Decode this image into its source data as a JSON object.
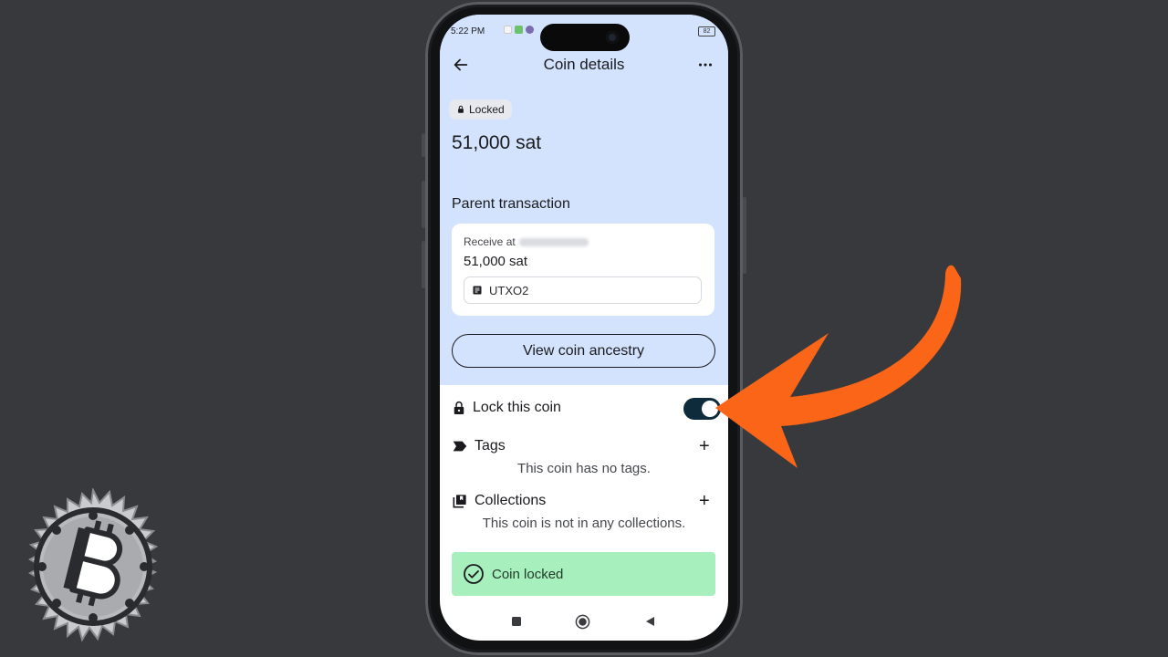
{
  "status_bar": {
    "time": "5:22 PM",
    "battery": "82"
  },
  "app_bar": {
    "title": "Coin details"
  },
  "coin": {
    "locked_chip": "Locked",
    "amount": "51,000 sat"
  },
  "parent_transaction": {
    "heading": "Parent transaction",
    "receive_prefix": "Receive at",
    "amount": "51,000 sat",
    "utxo_label": "UTXO2"
  },
  "ancestry_button": "View coin ancestry",
  "lock_row": {
    "label": "Lock this coin",
    "enabled": true
  },
  "tags": {
    "label": "Tags",
    "empty_text": "This coin has no tags."
  },
  "collections": {
    "label": "Collections",
    "empty_text": "This coin is not in any collections."
  },
  "toast": {
    "text": "Coin locked"
  },
  "colors": {
    "top_area_bg": "#d3e3fd",
    "toggle_on": "#0d2b3a",
    "toast_bg": "#a8efbe",
    "annotation_arrow": "#fa6517",
    "page_bg": "#38393d"
  },
  "icons": {
    "back": "arrow-left-icon",
    "more": "more-horizontal-icon",
    "lock": "lock-icon",
    "tag": "tag-icon",
    "collections": "collections-icon",
    "check": "check-circle-icon",
    "utxo": "document-icon",
    "overlay_logo": "bitcoin-gear-logo",
    "overlay_arrow": "annotation-arrow"
  }
}
